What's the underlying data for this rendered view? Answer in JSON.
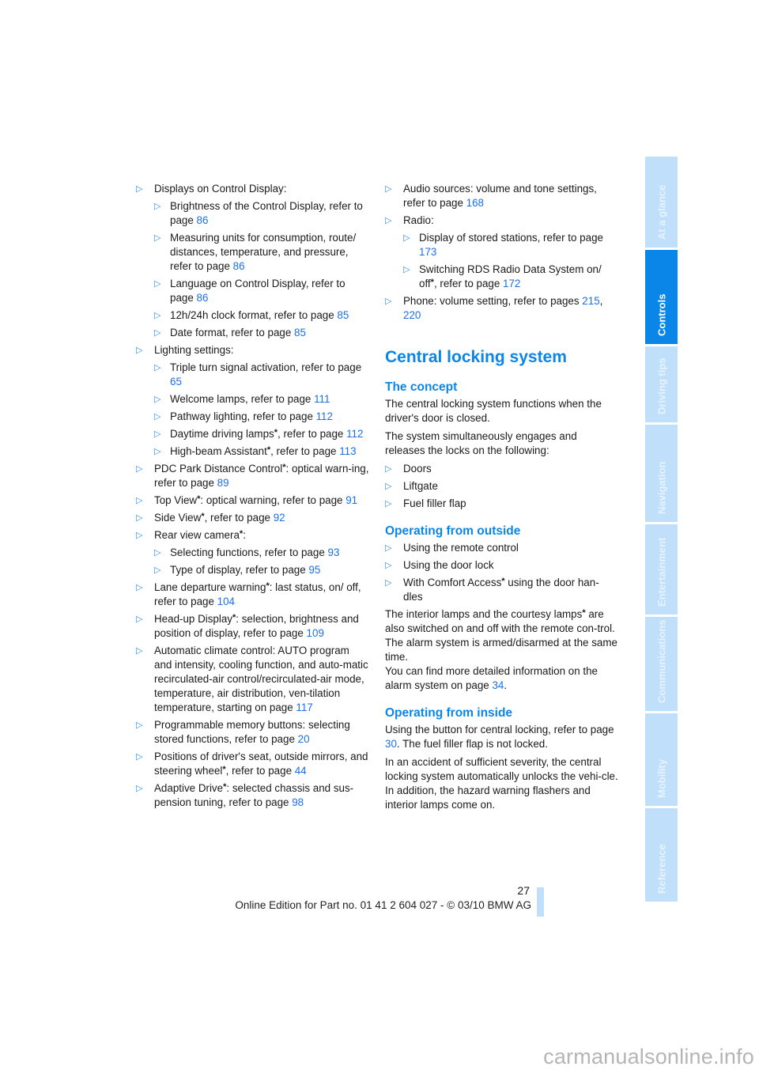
{
  "left_column": {
    "items": [
      {
        "text": "Displays on Control Display:",
        "sub": [
          {
            "pre": "Brightness of the Control Display, refer to page ",
            "link": "86"
          },
          {
            "pre": "Measuring units for consumption, route/ distances, temperature, and pressure, refer to page ",
            "link": "86"
          },
          {
            "pre": "Language on Control Display, refer to page ",
            "link": "86"
          },
          {
            "pre": "12h/24h clock format, refer to page ",
            "link": "85"
          },
          {
            "pre": "Date format, refer to page ",
            "link": "85"
          }
        ]
      },
      {
        "text": "Lighting settings:",
        "sub": [
          {
            "pre": "Triple turn signal activation, refer to page ",
            "link": "65"
          },
          {
            "pre": "Welcome lamps, refer to page ",
            "link": "111"
          },
          {
            "pre": "Pathway lighting, refer to page ",
            "link": "112"
          },
          {
            "pre": "Daytime driving lamps",
            "star": true,
            "post": ", refer to page ",
            "link": "112"
          },
          {
            "pre": "High-beam Assistant",
            "star": true,
            "post": ", refer to page ",
            "link": "113"
          }
        ]
      },
      {
        "pre": "PDC Park Distance Control",
        "star": true,
        "post": ": optical warn-ing, refer to page ",
        "link": "89"
      },
      {
        "pre": "Top View",
        "star": true,
        "post": ": optical warning, refer to page ",
        "link": "91"
      },
      {
        "pre": "Side View",
        "star": true,
        "post": ", refer to page ",
        "link": "92"
      },
      {
        "pre": "Rear view camera",
        "star": true,
        "post": ":",
        "sub": [
          {
            "pre": "Selecting functions, refer to page ",
            "link": "93"
          },
          {
            "pre": "Type of display, refer to page ",
            "link": "95"
          }
        ]
      },
      {
        "pre": "Lane departure warning",
        "star": true,
        "post": ": last status, on/ off, refer to page ",
        "link": "104"
      },
      {
        "pre": "Head-up Display",
        "star": true,
        "post": ": selection, brightness and position of display, refer to page ",
        "link": "109"
      },
      {
        "pre": "Automatic climate control: AUTO program and intensity, cooling function, and auto-matic recirculated-air control/recirculated-air mode, temperature, air distribution, ven-tilation temperature, starting on page ",
        "link": "117"
      },
      {
        "pre": "Programmable memory buttons: selecting stored functions, refer to page ",
        "link": "20"
      },
      {
        "pre": "Positions of driver's seat, outside mirrors, and steering wheel",
        "star": true,
        "post": ", refer to page ",
        "link": "44"
      },
      {
        "pre": "Adaptive Drive",
        "star": true,
        "post": ": selected chassis and sus-pension tuning, refer to page ",
        "link": "98"
      }
    ]
  },
  "right_column": {
    "items": [
      {
        "pre": "Audio sources: volume and tone settings, refer to page ",
        "link": "168"
      },
      {
        "text": "Radio:",
        "sub": [
          {
            "pre": "Display of stored stations, refer to page ",
            "link": "173"
          },
          {
            "pre": "Switching RDS Radio Data System on/ off",
            "star": true,
            "post": ", refer to page ",
            "link": "172"
          }
        ]
      },
      {
        "pre": "Phone: volume setting, refer to pages ",
        "link": "215",
        "sep": ", ",
        "link2": "220"
      }
    ],
    "section_title": "Central locking system",
    "concept": {
      "heading": "The concept",
      "p1": "The central locking system functions when the driver's door is closed.",
      "p2": "The system simultaneously engages and releases the locks on the following:",
      "list": [
        "Doors",
        "Liftgate",
        "Fuel filler flap"
      ]
    },
    "outside": {
      "heading": "Operating from outside",
      "list": [
        "Using the remote control",
        "Using the door lock"
      ],
      "comfort_pre": "With Comfort Access",
      "comfort_post": " using the door han-dles",
      "p1_pre": "The interior lamps and the courtesy lamps",
      "p1_post": " are also switched on and off with the remote con-trol. The alarm system is armed/disarmed at the same time.",
      "p2_pre": "You can find more detailed information on the alarm system on page ",
      "p2_link": "34",
      "p2_post": "."
    },
    "inside": {
      "heading": "Operating from inside",
      "p1_pre": "Using the button for central locking, refer to page ",
      "p1_link": "30",
      "p1_post": ". The fuel filler flap is not locked.",
      "p2": "In an accident of sufficient severity, the central locking system automatically unlocks the vehi-cle. In addition, the hazard warning flashers and interior lamps come on."
    }
  },
  "side_tabs": [
    {
      "label": "At a glance",
      "active": false
    },
    {
      "label": "Controls",
      "active": true
    },
    {
      "label": "Driving tips",
      "active": false
    },
    {
      "label": "Navigation",
      "active": false
    },
    {
      "label": "Entertainment",
      "active": false
    },
    {
      "label": "Communications",
      "active": false
    },
    {
      "label": "Mobility",
      "active": false
    },
    {
      "label": "Reference",
      "active": false
    }
  ],
  "page_number": "27",
  "footer": "Online Edition for Part no. 01 41 2 604 027 - © 03/10 BMW AG",
  "watermark": "carmanualsonline.info",
  "colors": {
    "accent": "#0a86e8",
    "link": "#1c6fe6",
    "tab_inactive": "#bfdffb"
  },
  "glyphs": {
    "bullet": "▷",
    "star": "*"
  }
}
